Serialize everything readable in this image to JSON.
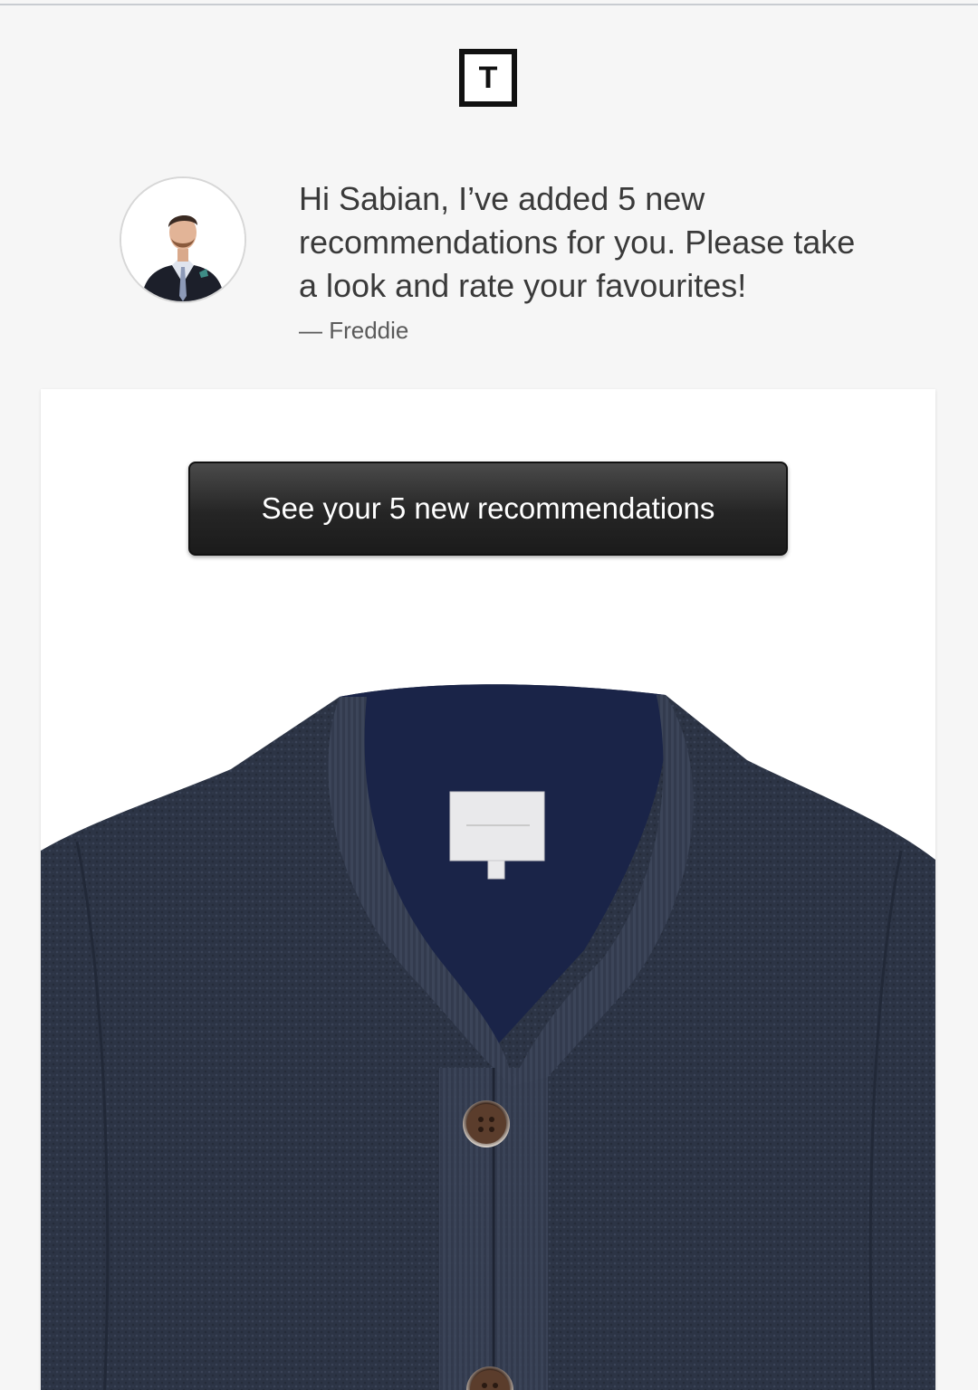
{
  "brand": {
    "logo_letter": "T"
  },
  "stylist": {
    "avatar_icon": "stylist-portrait",
    "message": "Hi Sabian, I’ve added 5 new recommendations for you. Please take a look and rate your favourites!",
    "signature": "— Freddie"
  },
  "cta": {
    "label": "See your 5 new recommendations"
  },
  "product": {
    "image_icon": "navy-knit-cardigan"
  },
  "colors": {
    "background": "#f6f6f6",
    "card": "#ffffff",
    "button": "#252525",
    "knit": "#2b3446"
  }
}
